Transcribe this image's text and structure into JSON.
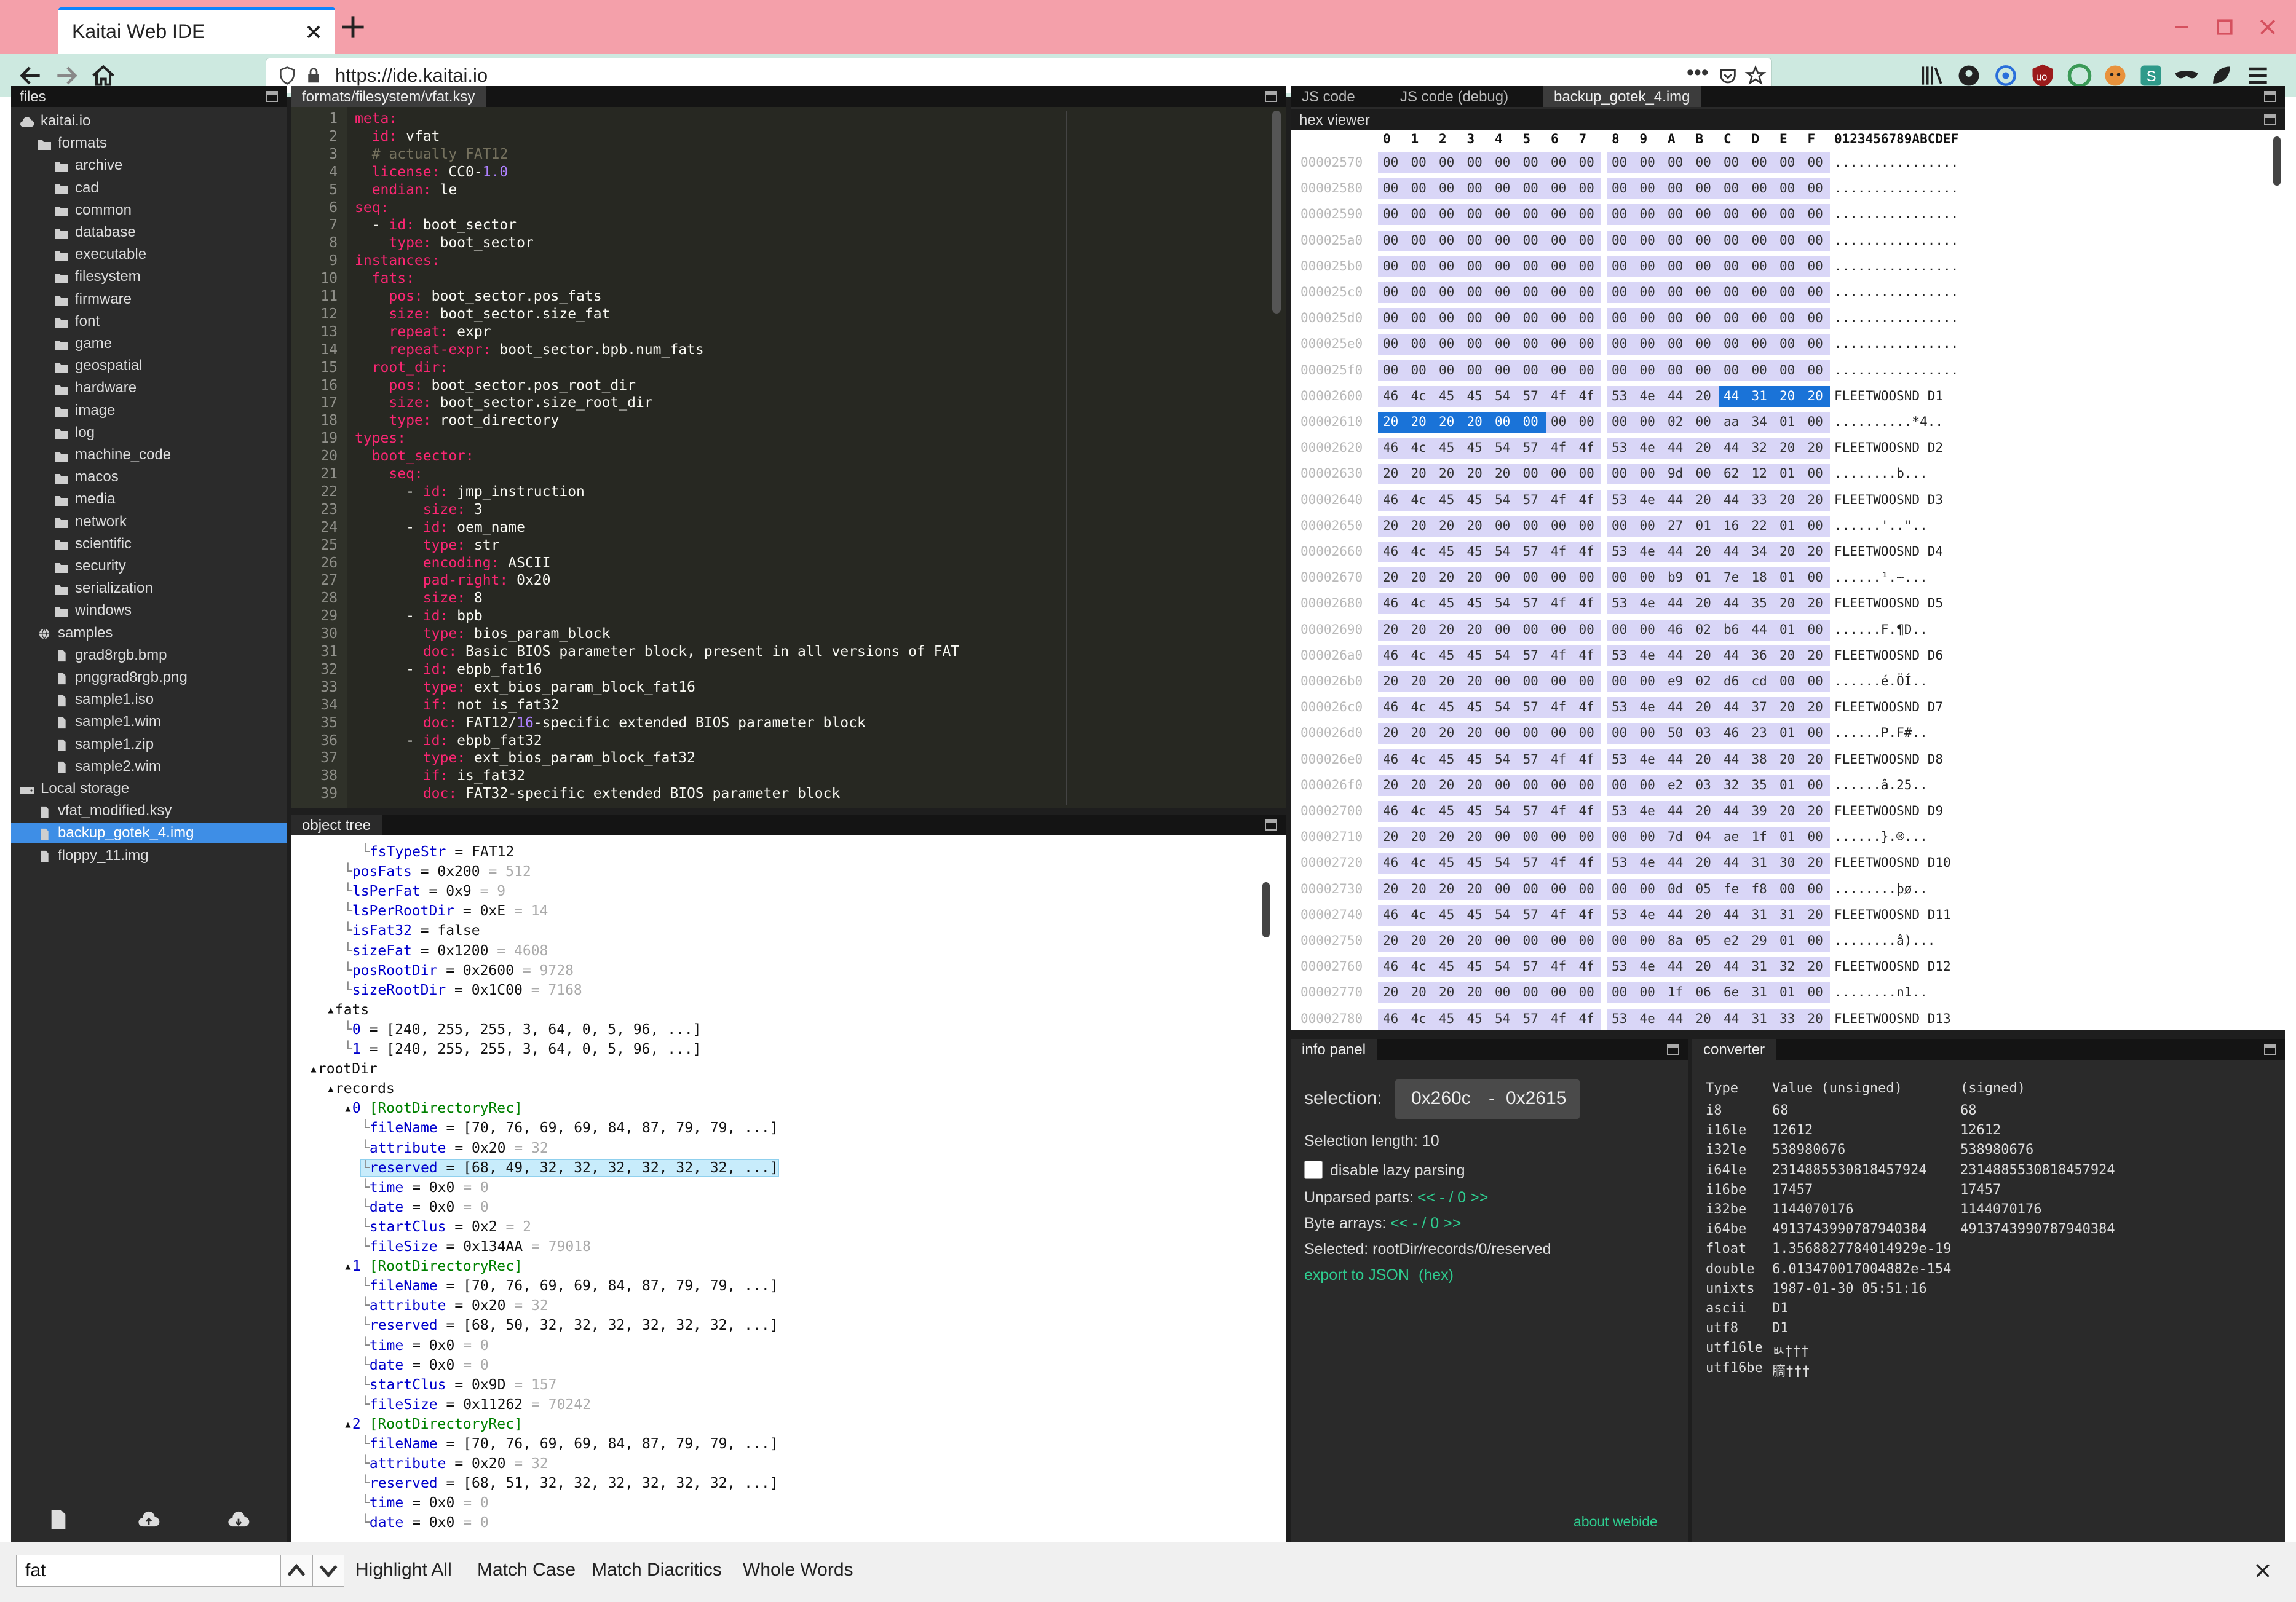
{
  "browser": {
    "tab_title": "Kaitai Web IDE",
    "url": "https://ide.kaitai.io"
  },
  "files": {
    "title": "files",
    "items": [
      {
        "label": "kaitai.io",
        "type": "cloud",
        "level": 0
      },
      {
        "label": "formats",
        "type": "folder",
        "level": 1
      },
      {
        "label": "archive",
        "type": "folder",
        "level": 2
      },
      {
        "label": "cad",
        "type": "folder",
        "level": 2
      },
      {
        "label": "common",
        "type": "folder",
        "level": 2
      },
      {
        "label": "database",
        "type": "folder",
        "level": 2
      },
      {
        "label": "executable",
        "type": "folder",
        "level": 2
      },
      {
        "label": "filesystem",
        "type": "folder",
        "level": 2
      },
      {
        "label": "firmware",
        "type": "folder",
        "level": 2
      },
      {
        "label": "font",
        "type": "folder",
        "level": 2
      },
      {
        "label": "game",
        "type": "folder",
        "level": 2
      },
      {
        "label": "geospatial",
        "type": "folder",
        "level": 2
      },
      {
        "label": "hardware",
        "type": "folder",
        "level": 2
      },
      {
        "label": "image",
        "type": "folder",
        "level": 2
      },
      {
        "label": "log",
        "type": "folder",
        "level": 2
      },
      {
        "label": "machine_code",
        "type": "folder",
        "level": 2
      },
      {
        "label": "macos",
        "type": "folder",
        "level": 2
      },
      {
        "label": "media",
        "type": "folder",
        "level": 2
      },
      {
        "label": "network",
        "type": "folder",
        "level": 2
      },
      {
        "label": "scientific",
        "type": "folder",
        "level": 2
      },
      {
        "label": "security",
        "type": "folder",
        "level": 2
      },
      {
        "label": "serialization",
        "type": "folder",
        "level": 2
      },
      {
        "label": "windows",
        "type": "folder",
        "level": 2
      },
      {
        "label": "samples",
        "type": "globe",
        "level": 1
      },
      {
        "label": "grad8rgb.bmp",
        "type": "file",
        "level": 2
      },
      {
        "label": "pnggrad8rgb.png",
        "type": "file",
        "level": 2
      },
      {
        "label": "sample1.iso",
        "type": "file",
        "level": 2
      },
      {
        "label": "sample1.wim",
        "type": "file",
        "level": 2
      },
      {
        "label": "sample1.zip",
        "type": "file",
        "level": 2
      },
      {
        "label": "sample2.wim",
        "type": "file",
        "level": 2
      },
      {
        "label": "Local storage",
        "type": "drive",
        "level": 0
      },
      {
        "label": "vfat_modified.ksy",
        "type": "file",
        "level": 1
      },
      {
        "label": "backup_gotek_4.img",
        "type": "file",
        "level": 1,
        "selected": true
      },
      {
        "label": "floppy_11.img",
        "type": "file",
        "level": 1
      }
    ]
  },
  "editor": {
    "tab": "formats/filesystem/vfat.ksy",
    "lines": [
      [
        "1",
        "meta:"
      ],
      [
        "2",
        "  id: vfat"
      ],
      [
        "3",
        "  # actually FAT12"
      ],
      [
        "4",
        "  license: CC0-1.0"
      ],
      [
        "5",
        "  endian: le"
      ],
      [
        "6",
        "seq:"
      ],
      [
        "7",
        "  - id: boot_sector"
      ],
      [
        "8",
        "    type: boot_sector"
      ],
      [
        "9",
        "instances:"
      ],
      [
        "10",
        "  fats:"
      ],
      [
        "11",
        "    pos: boot_sector.pos_fats"
      ],
      [
        "12",
        "    size: boot_sector.size_fat"
      ],
      [
        "13",
        "    repeat: expr"
      ],
      [
        "14",
        "    repeat-expr: boot_sector.bpb.num_fats"
      ],
      [
        "15",
        "  root_dir:"
      ],
      [
        "16",
        "    pos: boot_sector.pos_root_dir"
      ],
      [
        "17",
        "    size: boot_sector.size_root_dir"
      ],
      [
        "18",
        "    type: root_directory"
      ],
      [
        "19",
        "types:"
      ],
      [
        "20",
        "  boot_sector:"
      ],
      [
        "21",
        "    seq:"
      ],
      [
        "22",
        "      - id: jmp_instruction"
      ],
      [
        "23",
        "        size: 3"
      ],
      [
        "24",
        "      - id: oem_name"
      ],
      [
        "25",
        "        type: str"
      ],
      [
        "26",
        "        encoding: ASCII"
      ],
      [
        "27",
        "        pad-right: 0x20"
      ],
      [
        "28",
        "        size: 8"
      ],
      [
        "29",
        "      - id: bpb"
      ],
      [
        "30",
        "        type: bios_param_block"
      ],
      [
        "31",
        "        doc: Basic BIOS parameter block, present in all versions of FAT"
      ],
      [
        "32",
        "      - id: ebpb_fat16"
      ],
      [
        "33",
        "        type: ext_bios_param_block_fat16"
      ],
      [
        "34",
        "        if: not is_fat32"
      ],
      [
        "35",
        "        doc: FAT12/16-specific extended BIOS parameter block"
      ],
      [
        "36",
        "      - id: ebpb_fat32"
      ],
      [
        "37",
        "        type: ext_bios_param_block_fat32"
      ],
      [
        "38",
        "        if: is_fat32"
      ],
      [
        "39",
        "        doc: FAT32-specific extended BIOS parameter block"
      ]
    ]
  },
  "objtree": {
    "title": "object tree",
    "rows": [
      {
        "indent": 2,
        "key": "fsTypeStr",
        "val": "FAT12",
        "dec": ""
      },
      {
        "indent": 1,
        "key": "posFats",
        "val": "0x200",
        "dec": "512"
      },
      {
        "indent": 1,
        "key": "lsPerFat",
        "val": "0x9",
        "dec": "9"
      },
      {
        "indent": 1,
        "key": "lsPerRootDir",
        "val": "0xE",
        "dec": "14"
      },
      {
        "indent": 1,
        "key": "isFat32",
        "val": "false",
        "dec": ""
      },
      {
        "indent": 1,
        "key": "sizeFat",
        "val": "0x1200",
        "dec": "4608"
      },
      {
        "indent": 1,
        "key": "posRootDir",
        "val": "0x2600",
        "dec": "9728"
      },
      {
        "indent": 1,
        "key": "sizeRootDir",
        "val": "0x1C00",
        "dec": "7168"
      },
      {
        "indent": 0,
        "key": "fats",
        "val": "",
        "dec": "",
        "node": true
      },
      {
        "indent": 1,
        "key": "0",
        "val": "[240, 255, 255, 3, 64, 0, 5, 96, ...]",
        "dec": ""
      },
      {
        "indent": 1,
        "key": "1",
        "val": "[240, 255, 255, 3, 64, 0, 5, 96, ...]",
        "dec": ""
      },
      {
        "indent": -1,
        "key": "rootDir",
        "val": "",
        "dec": "",
        "node": true
      },
      {
        "indent": 0,
        "key": "records",
        "val": "",
        "dec": "",
        "node": true
      },
      {
        "indent": 1,
        "key": "0",
        "val": "",
        "dec": "",
        "cls": "[RootDirectoryRec]",
        "node": true
      },
      {
        "indent": 2,
        "key": "fileName",
        "val": "[70, 76, 69, 69, 84, 87, 79, 79, ...]",
        "dec": ""
      },
      {
        "indent": 2,
        "key": "attribute",
        "val": "0x20",
        "dec": "32"
      },
      {
        "indent": 2,
        "key": "reserved",
        "val": "[68, 49, 32, 32, 32, 32, 32, 32, ...]",
        "dec": "",
        "hl": true
      },
      {
        "indent": 2,
        "key": "time",
        "val": "0x0",
        "dec": "0"
      },
      {
        "indent": 2,
        "key": "date",
        "val": "0x0",
        "dec": "0"
      },
      {
        "indent": 2,
        "key": "startClus",
        "val": "0x2",
        "dec": "2"
      },
      {
        "indent": 2,
        "key": "fileSize",
        "val": "0x134AA",
        "dec": "79018"
      },
      {
        "indent": 1,
        "key": "1",
        "val": "",
        "dec": "",
        "cls": "[RootDirectoryRec]",
        "node": true
      },
      {
        "indent": 2,
        "key": "fileName",
        "val": "[70, 76, 69, 69, 84, 87, 79, 79, ...]",
        "dec": ""
      },
      {
        "indent": 2,
        "key": "attribute",
        "val": "0x20",
        "dec": "32"
      },
      {
        "indent": 2,
        "key": "reserved",
        "val": "[68, 50, 32, 32, 32, 32, 32, 32, ...]",
        "dec": ""
      },
      {
        "indent": 2,
        "key": "time",
        "val": "0x0",
        "dec": "0"
      },
      {
        "indent": 2,
        "key": "date",
        "val": "0x0",
        "dec": "0"
      },
      {
        "indent": 2,
        "key": "startClus",
        "val": "0x9D",
        "dec": "157"
      },
      {
        "indent": 2,
        "key": "fileSize",
        "val": "0x11262",
        "dec": "70242"
      },
      {
        "indent": 1,
        "key": "2",
        "val": "",
        "dec": "",
        "cls": "[RootDirectoryRec]",
        "node": true
      },
      {
        "indent": 2,
        "key": "fileName",
        "val": "[70, 76, 69, 69, 84, 87, 79, 79, ...]",
        "dec": ""
      },
      {
        "indent": 2,
        "key": "attribute",
        "val": "0x20",
        "dec": "32"
      },
      {
        "indent": 2,
        "key": "reserved",
        "val": "[68, 51, 32, 32, 32, 32, 32, 32, ...]",
        "dec": ""
      },
      {
        "indent": 2,
        "key": "time",
        "val": "0x0",
        "dec": "0"
      },
      {
        "indent": 2,
        "key": "date",
        "val": "0x0",
        "dec": "0"
      }
    ]
  },
  "hex": {
    "tabs": [
      "JS code",
      "JS code (debug)",
      "backup_gotek_4.img"
    ],
    "title": "hex viewer",
    "header": [
      "0",
      "1",
      "2",
      "3",
      "4",
      "5",
      "6",
      "7",
      "8",
      "9",
      "A",
      "B",
      "C",
      "D",
      "E",
      "F"
    ],
    "ascii_header": "0123456789ABCDEF",
    "rows": [
      {
        "addr": "00002570",
        "bytes": "00 00 00 00 00 00 00 00 00 00 00 00 00 00 00 00",
        "ascii": "................"
      },
      {
        "addr": "00002580",
        "bytes": "00 00 00 00 00 00 00 00 00 00 00 00 00 00 00 00",
        "ascii": "................"
      },
      {
        "addr": "00002590",
        "bytes": "00 00 00 00 00 00 00 00 00 00 00 00 00 00 00 00",
        "ascii": "................"
      },
      {
        "addr": "000025a0",
        "bytes": "00 00 00 00 00 00 00 00 00 00 00 00 00 00 00 00",
        "ascii": "................"
      },
      {
        "addr": "000025b0",
        "bytes": "00 00 00 00 00 00 00 00 00 00 00 00 00 00 00 00",
        "ascii": "................"
      },
      {
        "addr": "000025c0",
        "bytes": "00 00 00 00 00 00 00 00 00 00 00 00 00 00 00 00",
        "ascii": "................"
      },
      {
        "addr": "000025d0",
        "bytes": "00 00 00 00 00 00 00 00 00 00 00 00 00 00 00 00",
        "ascii": "................"
      },
      {
        "addr": "000025e0",
        "bytes": "00 00 00 00 00 00 00 00 00 00 00 00 00 00 00 00",
        "ascii": "................"
      },
      {
        "addr": "000025f0",
        "bytes": "00 00 00 00 00 00 00 00 00 00 00 00 00 00 00 00",
        "ascii": "................"
      },
      {
        "addr": "00002600",
        "bytes": "46 4c 45 45 54 57 4f 4f 53 4e 44 20 44 31 20 20",
        "ascii": "FLEETWOOSND D1"
      },
      {
        "addr": "00002610",
        "bytes": "20 20 20 20 00 00 00 00 00 00 02 00 aa 34 01 00",
        "ascii": "..........*4.."
      },
      {
        "addr": "00002620",
        "bytes": "46 4c 45 45 54 57 4f 4f 53 4e 44 20 44 32 20 20",
        "ascii": "FLEETWOOSND D2"
      },
      {
        "addr": "00002630",
        "bytes": "20 20 20 20 20 00 00 00 00 00 9d 00 62 12 01 00",
        "ascii": "........b..."
      },
      {
        "addr": "00002640",
        "bytes": "46 4c 45 45 54 57 4f 4f 53 4e 44 20 44 33 20 20",
        "ascii": "FLEETWOOSND D3"
      },
      {
        "addr": "00002650",
        "bytes": "20 20 20 20 00 00 00 00 00 00 27 01 16 22 01 00",
        "ascii": "......'..\".."
      },
      {
        "addr": "00002660",
        "bytes": "46 4c 45 45 54 57 4f 4f 53 4e 44 20 44 34 20 20",
        "ascii": "FLEETWOOSND D4"
      },
      {
        "addr": "00002670",
        "bytes": "20 20 20 20 00 00 00 00 00 00 b9 01 7e 18 01 00",
        "ascii": "......¹.~..."
      },
      {
        "addr": "00002680",
        "bytes": "46 4c 45 45 54 57 4f 4f 53 4e 44 20 44 35 20 20",
        "ascii": "FLEETWOOSND D5"
      },
      {
        "addr": "00002690",
        "bytes": "20 20 20 20 00 00 00 00 00 00 46 02 b6 44 01 00",
        "ascii": "......F.¶D.."
      },
      {
        "addr": "000026a0",
        "bytes": "46 4c 45 45 54 57 4f 4f 53 4e 44 20 44 36 20 20",
        "ascii": "FLEETWOOSND D6"
      },
      {
        "addr": "000026b0",
        "bytes": "20 20 20 20 00 00 00 00 00 00 e9 02 d6 cd 00 00",
        "ascii": "......é.ÖÍ.."
      },
      {
        "addr": "000026c0",
        "bytes": "46 4c 45 45 54 57 4f 4f 53 4e 44 20 44 37 20 20",
        "ascii": "FLEETWOOSND D7"
      },
      {
        "addr": "000026d0",
        "bytes": "20 20 20 20 00 00 00 00 00 00 50 03 46 23 01 00",
        "ascii": "......P.F#.."
      },
      {
        "addr": "000026e0",
        "bytes": "46 4c 45 45 54 57 4f 4f 53 4e 44 20 44 38 20 20",
        "ascii": "FLEETWOOSND D8"
      },
      {
        "addr": "000026f0",
        "bytes": "20 20 20 20 00 00 00 00 00 00 e2 03 32 35 01 00",
        "ascii": "......â.25.."
      },
      {
        "addr": "00002700",
        "bytes": "46 4c 45 45 54 57 4f 4f 53 4e 44 20 44 39 20 20",
        "ascii": "FLEETWOOSND D9"
      },
      {
        "addr": "00002710",
        "bytes": "20 20 20 20 00 00 00 00 00 00 7d 04 ae 1f 01 00",
        "ascii": "......}.®..."
      },
      {
        "addr": "00002720",
        "bytes": "46 4c 45 45 54 57 4f 4f 53 4e 44 20 44 31 30 20",
        "ascii": "FLEETWOOSND D10"
      },
      {
        "addr": "00002730",
        "bytes": "20 20 20 20 00 00 00 00 00 00 0d 05 fe f8 00 00",
        "ascii": "........þø.."
      },
      {
        "addr": "00002740",
        "bytes": "46 4c 45 45 54 57 4f 4f 53 4e 44 20 44 31 31 20",
        "ascii": "FLEETWOOSND D11"
      },
      {
        "addr": "00002750",
        "bytes": "20 20 20 20 00 00 00 00 00 00 8a 05 e2 29 01 00",
        "ascii": "........â)..."
      },
      {
        "addr": "00002760",
        "bytes": "46 4c 45 45 54 57 4f 4f 53 4e 44 20 44 31 32 20",
        "ascii": "FLEETWOOSND D12"
      },
      {
        "addr": "00002770",
        "bytes": "20 20 20 20 00 00 00 00 00 00 1f 06 6e 31 01 00",
        "ascii": "........n1.."
      },
      {
        "addr": "00002780",
        "bytes": "46 4c 45 45 54 57 4f 4f 53 4e 44 20 44 31 33 20",
        "ascii": "FLEETWOOSND D13"
      }
    ]
  },
  "info": {
    "title": "info panel",
    "selection_label": "selection:",
    "selection_from": "0x260c",
    "selection_sep": "-",
    "selection_to": "0x2615",
    "selection_length": "Selection length: 10",
    "lazy_label": "disable lazy parsing",
    "unparsed_label": "Unparsed parts:",
    "unparsed_nav": "<< - / 0 >>",
    "byte_arrays_label": "Byte arrays:",
    "byte_arrays_nav": "<< - / 0 >>",
    "selected_path": "Selected: rootDir/records/0/reserved",
    "export_label": "export to JSON",
    "export_hex": "(hex)",
    "about": "about webide"
  },
  "converter": {
    "title": "converter",
    "head": [
      "Type",
      "Value (unsigned)",
      "(signed)"
    ],
    "rows": [
      [
        "i8",
        "68",
        "68"
      ],
      [
        "i16le",
        "12612",
        "12612"
      ],
      [
        "i32le",
        "538980676",
        "538980676"
      ],
      [
        "i64le",
        "2314885530818457924",
        "2314885530818457924"
      ],
      [
        "i16be",
        "17457",
        "17457"
      ],
      [
        "i32be",
        "1144070176",
        "1144070176"
      ],
      [
        "i64be",
        "4913743990787940384",
        "4913743990787940384"
      ],
      [
        "float",
        "1.3568827784014929e-19",
        ""
      ],
      [
        "double",
        "6.013470017004882e-154",
        ""
      ],
      [
        "unixts",
        "1987-01-30 05:51:16",
        ""
      ],
      [
        "ascii",
        "D1",
        ""
      ],
      [
        "utf8",
        "D1",
        ""
      ],
      [
        "utf16le",
        "ㅄ†††",
        ""
      ],
      [
        "utf16be",
        "䐱††† ",
        ""
      ]
    ]
  },
  "findbar": {
    "value": "fat",
    "highlight_all": "Highlight All",
    "match_case": "Match Case",
    "match_diacritics": "Match Diacritics",
    "whole_words": "Whole Words"
  }
}
